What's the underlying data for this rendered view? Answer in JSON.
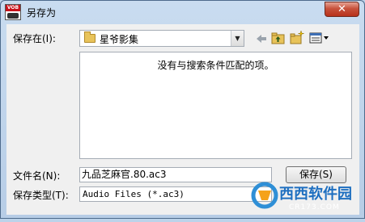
{
  "window": {
    "title": "另存为",
    "close_label": "✕"
  },
  "app_icon": {
    "label": "VOB"
  },
  "save_in": {
    "label": "保存在(I):",
    "value": "星爷影集"
  },
  "file_list": {
    "empty_message": "没有与搜索条件匹配的项。"
  },
  "file_name": {
    "label": "文件名(N):",
    "value": "九品芝麻官.80.ac3"
  },
  "file_type": {
    "label": "保存类型(T):",
    "value": "Audio Files (*.ac3)"
  },
  "buttons": {
    "save": "保存(S)"
  },
  "watermark": {
    "brand": "西西软件园",
    "url": "CR173.COM"
  },
  "colors": {
    "title_bar": "#bcd3ea",
    "close_red": "#c7523c",
    "folder": "#e8c35a"
  }
}
